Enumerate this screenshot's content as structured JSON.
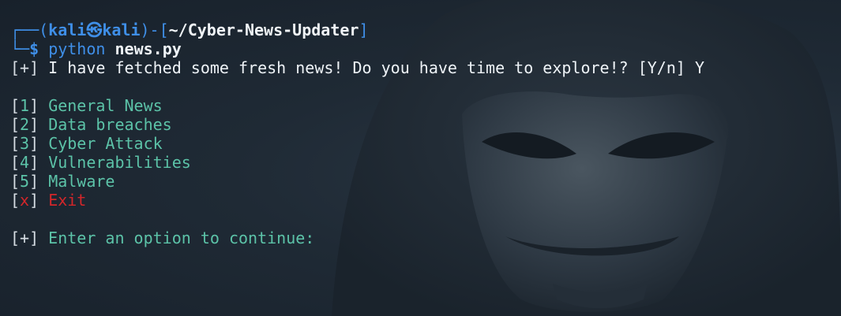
{
  "prompt": {
    "corner_top": "┌──(",
    "user": "kali",
    "at_symbol": "㉿",
    "host": "kali",
    "sep_open": ")-[",
    "path": "~/Cyber-News-Updater",
    "sep_close": "]",
    "corner_bottom": "└─",
    "dollar": "$",
    "command": "python",
    "argument": "news.py"
  },
  "intro": {
    "marker": "[+]",
    "text": "I have fetched some fresh news! Do you have time to explore!? [Y/n] Y"
  },
  "menu": [
    {
      "key": "1",
      "label": "General News",
      "color": "#5cc3a8"
    },
    {
      "key": "2",
      "label": "Data breaches",
      "color": "#5cc3a8"
    },
    {
      "key": "3",
      "label": "Cyber Attack",
      "color": "#5cc3a8"
    },
    {
      "key": "4",
      "label": "Vulnerabilities",
      "color": "#5cc3a8"
    },
    {
      "key": "5",
      "label": "Malware",
      "color": "#5cc3a8"
    },
    {
      "key": "x",
      "label": "Exit",
      "color": "#d3262a"
    }
  ],
  "footer": {
    "marker": "[+]",
    "text": "Enter an option to continue:"
  },
  "colors": {
    "prompt_blue": "#3f8fe8",
    "option_teal": "#5cc3a8",
    "exit_red": "#d3262a",
    "background": "#1d2631"
  }
}
